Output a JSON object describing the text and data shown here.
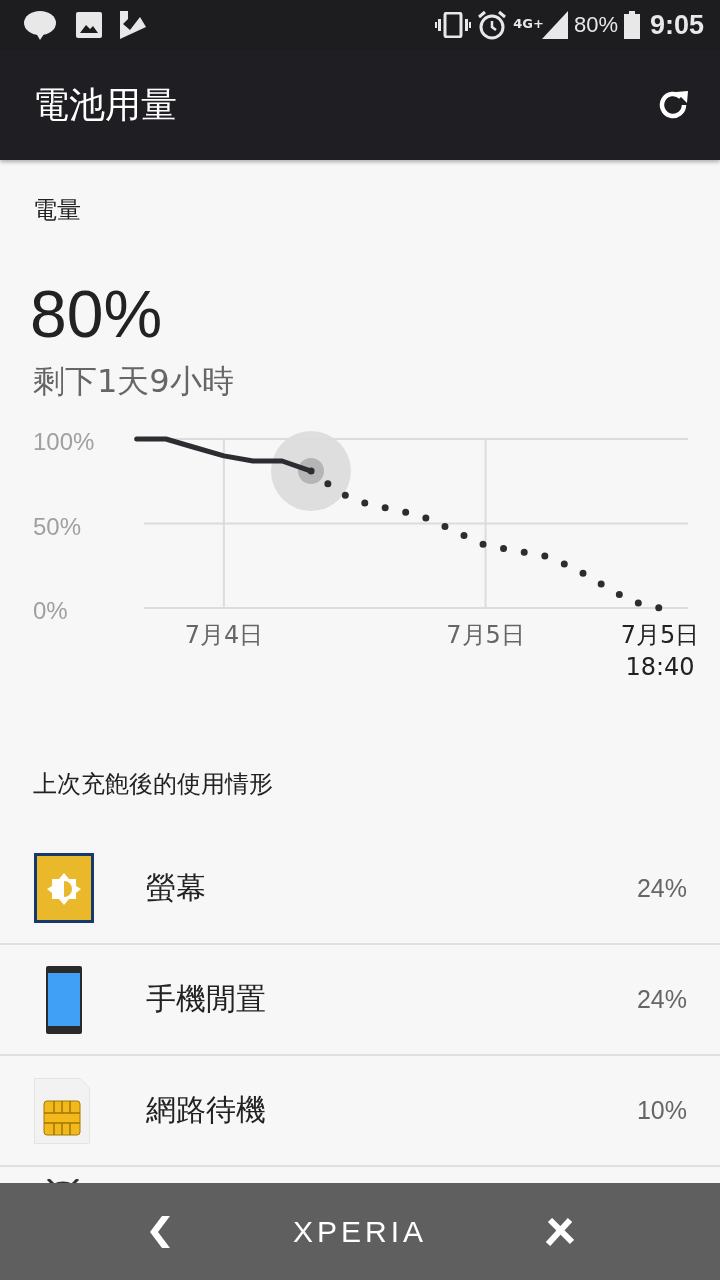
{
  "status_bar": {
    "network": "4G+",
    "battery": "80%",
    "time": "9:05"
  },
  "app_bar": {
    "title": "電池用量"
  },
  "battery": {
    "label": "電量",
    "percent": "80%",
    "remaining": "剩下1天9小時",
    "chart_data": {
      "type": "line",
      "categories": [
        null,
        null,
        null,
        "7月4日",
        null,
        null,
        null,
        null,
        null,
        null,
        null,
        null,
        "7月5日",
        null,
        null,
        null,
        null,
        null,
        "7月5日 18:40"
      ],
      "series": [
        {
          "color": "#2b2d31",
          "line_style": "solid",
          "values": [
            100,
            100,
            95,
            90,
            87,
            87,
            81,
            null,
            null,
            null,
            null,
            null,
            null,
            null,
            null,
            null,
            null,
            null,
            null
          ]
        },
        {
          "color": "#2b2d31",
          "line_style": "dotted",
          "values": [
            null,
            null,
            null,
            null,
            null,
            null,
            81,
            68,
            61,
            58,
            53,
            45,
            37,
            34,
            31,
            24,
            14,
            4,
            0
          ]
        }
      ],
      "ylim": [
        0,
        100
      ],
      "grid": true,
      "yticks": [
        {
          "value": 100,
          "label": "100%"
        },
        {
          "value": 50,
          "label": "50%"
        },
        {
          "value": 0,
          "label": "0%"
        }
      ]
    }
  },
  "usage": {
    "title": "上次充飽後的使用情形",
    "items": [
      {
        "kind": "screen",
        "name": "螢幕",
        "percent": "24%"
      },
      {
        "kind": "idle",
        "name": "手機閒置",
        "percent": "24%"
      },
      {
        "kind": "network",
        "name": "網路待機",
        "percent": "10%"
      }
    ]
  },
  "nav_bar": {
    "brand": "XPERIA"
  }
}
